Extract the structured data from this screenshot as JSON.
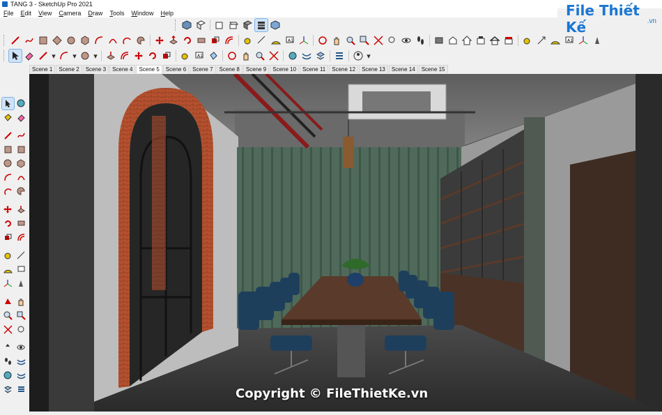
{
  "window": {
    "title": "TANG 3 - SketchUp Pro 2021"
  },
  "menu": [
    "File",
    "Edit",
    "View",
    "Camera",
    "Draw",
    "Tools",
    "Window",
    "Help"
  ],
  "logo": {
    "main": "File Thiết Kế",
    "suffix": ".vn"
  },
  "toolbar_row1_icons": [
    "cube-iso-icon",
    "cube-front-icon",
    "cube-right-icon",
    "cube-top-icon",
    "cube-wire-icon",
    "cube-shaded-icon",
    "cube-texture-icon"
  ],
  "scenes": {
    "tabs": [
      "Scene 1",
      "Scene 2",
      "Scene 3",
      "Scene 4",
      "Scene 5",
      "Scene 6",
      "Scene 7",
      "Scene 8",
      "Scene 9",
      "Scene 10",
      "Scene 11",
      "Scene 12",
      "Scene 13",
      "Scene 14",
      "Scene 15"
    ],
    "active": "Scene 5"
  },
  "watermark": "Copyright © FileThietKe.vn",
  "colors": {
    "brick": "#b5502e",
    "wall_green": "#4f6a5a",
    "table": "#5a3a2a",
    "chair": "#1e3f5c",
    "ceiling": "#6f6f6f",
    "pipe_red": "#8a1a1a",
    "accent": "#1976d2"
  }
}
